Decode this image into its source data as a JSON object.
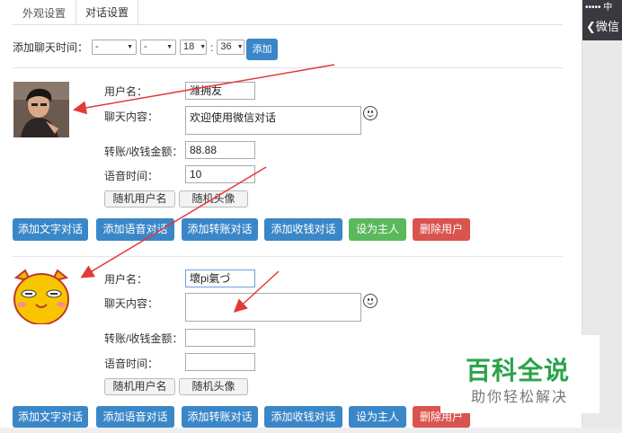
{
  "tabs": [
    {
      "label": "外观设置"
    },
    {
      "label": "对话设置"
    }
  ],
  "time_row": {
    "label": "添加聊天时间：",
    "year": "-",
    "month": "-",
    "hour": "18",
    "colon": ":",
    "minute": "36",
    "add_button": "添加"
  },
  "form_labels": {
    "username": "用户名：",
    "content": "聊天内容：",
    "amount": "转账/收钱金额：",
    "voice": "语音时间：",
    "random_name": "随机用户名",
    "random_avatar": "随机头像"
  },
  "users": [
    {
      "username": "潍拥友",
      "content": "欢迎使用微信对话",
      "amount": "88.88",
      "voice": "10"
    },
    {
      "username": "壞pi氣づ",
      "content": "",
      "amount": "",
      "voice": ""
    }
  ],
  "actions": {
    "add_text": "添加文字对话",
    "add_voice": "添加语音对话",
    "add_transfer": "添加转账对话",
    "add_receive": "添加收钱对话",
    "set_owner": "设为主人",
    "delete_user": "删除用户"
  },
  "phone": {
    "status": "••••• 中",
    "back": "微信"
  },
  "watermark": {
    "title": "百科全说",
    "subtitle": "助你轻松解决"
  },
  "colors": {
    "primary": "#3a87c8",
    "success": "#5cb85c",
    "danger": "#d9534f",
    "arrow": "#e23a3a",
    "brand": "#2aa34a"
  }
}
